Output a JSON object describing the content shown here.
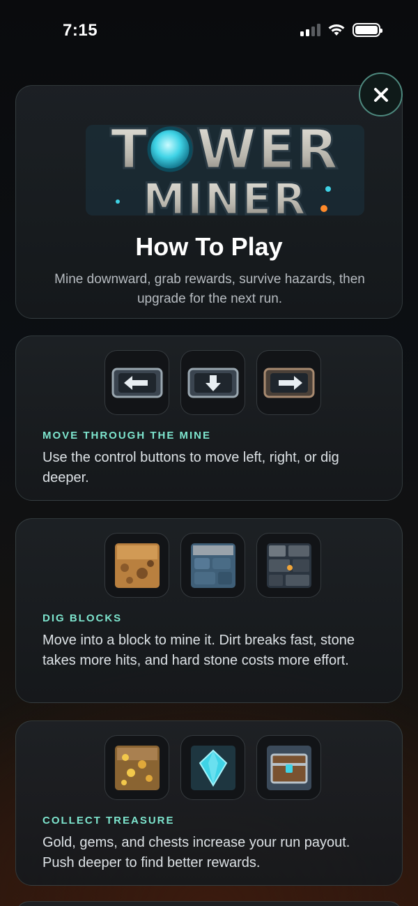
{
  "status_bar": {
    "time": "7:15"
  },
  "header": {
    "logo_line1": "TOWER",
    "logo_line2": "MINER",
    "title": "How To Play",
    "subtitle": "Mine downward, grab rewards, survive hazards, then upgrade for the next run."
  },
  "sections": [
    {
      "title": "MOVE THROUGH THE MINE",
      "text": "Use the control buttons to move left, right, or dig deeper.",
      "icons": [
        "arrow-left-icon",
        "arrow-down-icon",
        "arrow-right-icon"
      ]
    },
    {
      "title": "DIG BLOCKS",
      "text": "Move into a block to mine it. Dirt breaks fast, stone takes more hits, and hard stone costs more effort.",
      "icons": [
        "dirt-block-icon",
        "stone-block-icon",
        "hard-stone-block-icon"
      ]
    },
    {
      "title": "COLLECT TREASURE",
      "text": "Gold, gems, and chests increase your run payout. Push deeper to find better rewards.",
      "icons": [
        "gold-ore-icon",
        "gem-icon",
        "chest-icon"
      ]
    }
  ],
  "colors": {
    "accent": "#7ee6cf",
    "close_border": "#4e8a7f",
    "gem": "#3fd3e6",
    "gold": "#e0a83a",
    "dirt": "#b9803f",
    "stone": "#4a6c86"
  }
}
